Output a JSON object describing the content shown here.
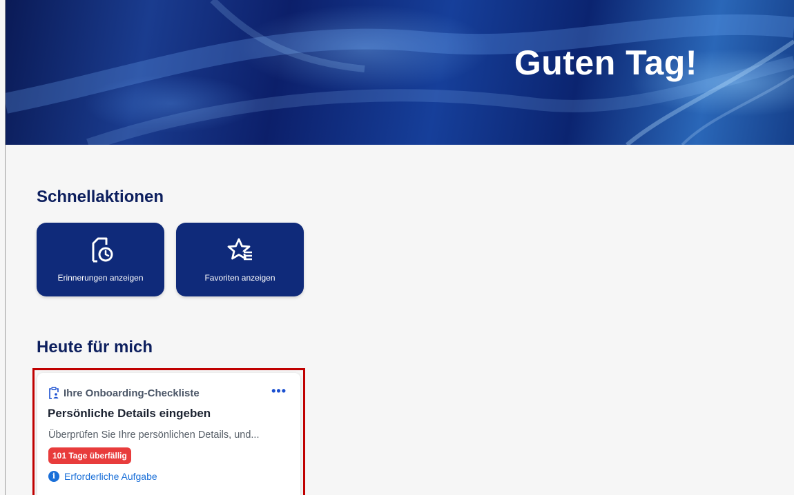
{
  "header": {
    "greeting": "Guten Tag!"
  },
  "quick_actions": {
    "title": "Schnellaktionen",
    "items": [
      {
        "label": "Erinnerungen anzeigen",
        "icon": "reminder-clock-icon"
      },
      {
        "label": "Favoriten anzeigen",
        "icon": "star-list-icon"
      }
    ]
  },
  "today": {
    "title": "Heute für mich",
    "card": {
      "category": "Ihre Onboarding-Checkliste",
      "category_icon": "clipboard-person-icon",
      "more_label": "•••",
      "title": "Persönliche Details eingeben",
      "description": "Überprüfen Sie Ihre persönlichen Details, und...",
      "badge": "101 Tage überfällig",
      "required_label": "Erforderliche Aufgabe",
      "required_icon": "info-icon"
    }
  },
  "colors": {
    "brand_navy": "#0f2a7a",
    "heading": "#0d1f5e",
    "overdue_red": "#e83c3c",
    "link_blue": "#1a6fd8",
    "highlight_outline": "#c00000"
  }
}
